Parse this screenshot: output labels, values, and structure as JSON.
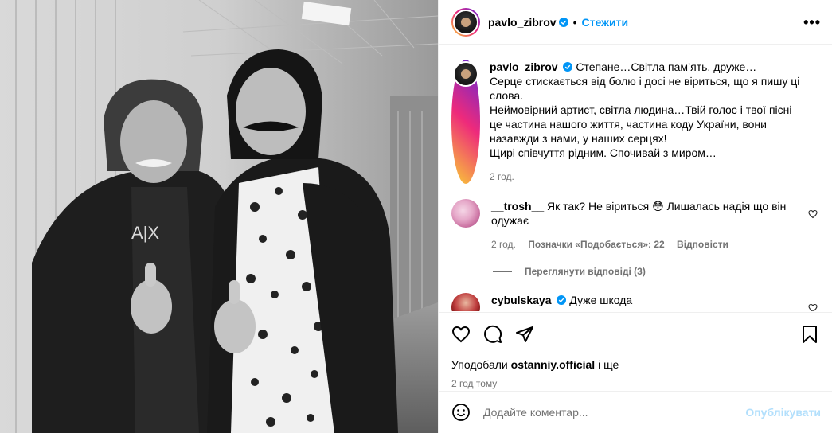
{
  "post": {
    "author": "pavlo_zibrov",
    "follow_label": "Стежити",
    "dot": "•",
    "more_label": "•••"
  },
  "caption": {
    "username": "pavlo_zibrov",
    "lines": [
      "Степане…Світла пам’ять, друже…",
      "Серце стискається від болю і досі не віриться, що я пишу ці слова.",
      "Неймовірний артист, світла людина…Твій голос і твої пісні — це частина нашого життя, частина коду України, вони назавжди з нами, у наших серцях!",
      "Щирі співчуття рідним. Спочивай з миром…"
    ],
    "time": "2 год."
  },
  "comments": [
    {
      "username": "__trosh__",
      "text": "Як так? Не віриться 😳 Лишалась надія що він одужає",
      "time": "2 год.",
      "likes": "Позначки «Подобається»: 22",
      "reply": "Відповісти",
      "view_replies": "Переглянути відповіді (3)"
    },
    {
      "username": "cybulskaya",
      "text": "Дуже шкода"
    }
  ],
  "actions": {
    "liked_by_prefix": "Уподобали ",
    "liked_by_user": "ostanniy.official",
    "liked_by_suffix": " і ще",
    "posted_time": "2 год тому"
  },
  "add_comment": {
    "placeholder": "Додайте коментар...",
    "publish_label": "Опублікувати"
  },
  "colors": {
    "accent": "#0095f6",
    "publish_disabled": "#b2dffc",
    "secondary_text": "#737373",
    "border": "#efefef"
  },
  "icons": [
    "verified-icon",
    "more-icon",
    "heart-icon",
    "comment-icon",
    "share-icon",
    "save-icon",
    "emoji-icon"
  ]
}
